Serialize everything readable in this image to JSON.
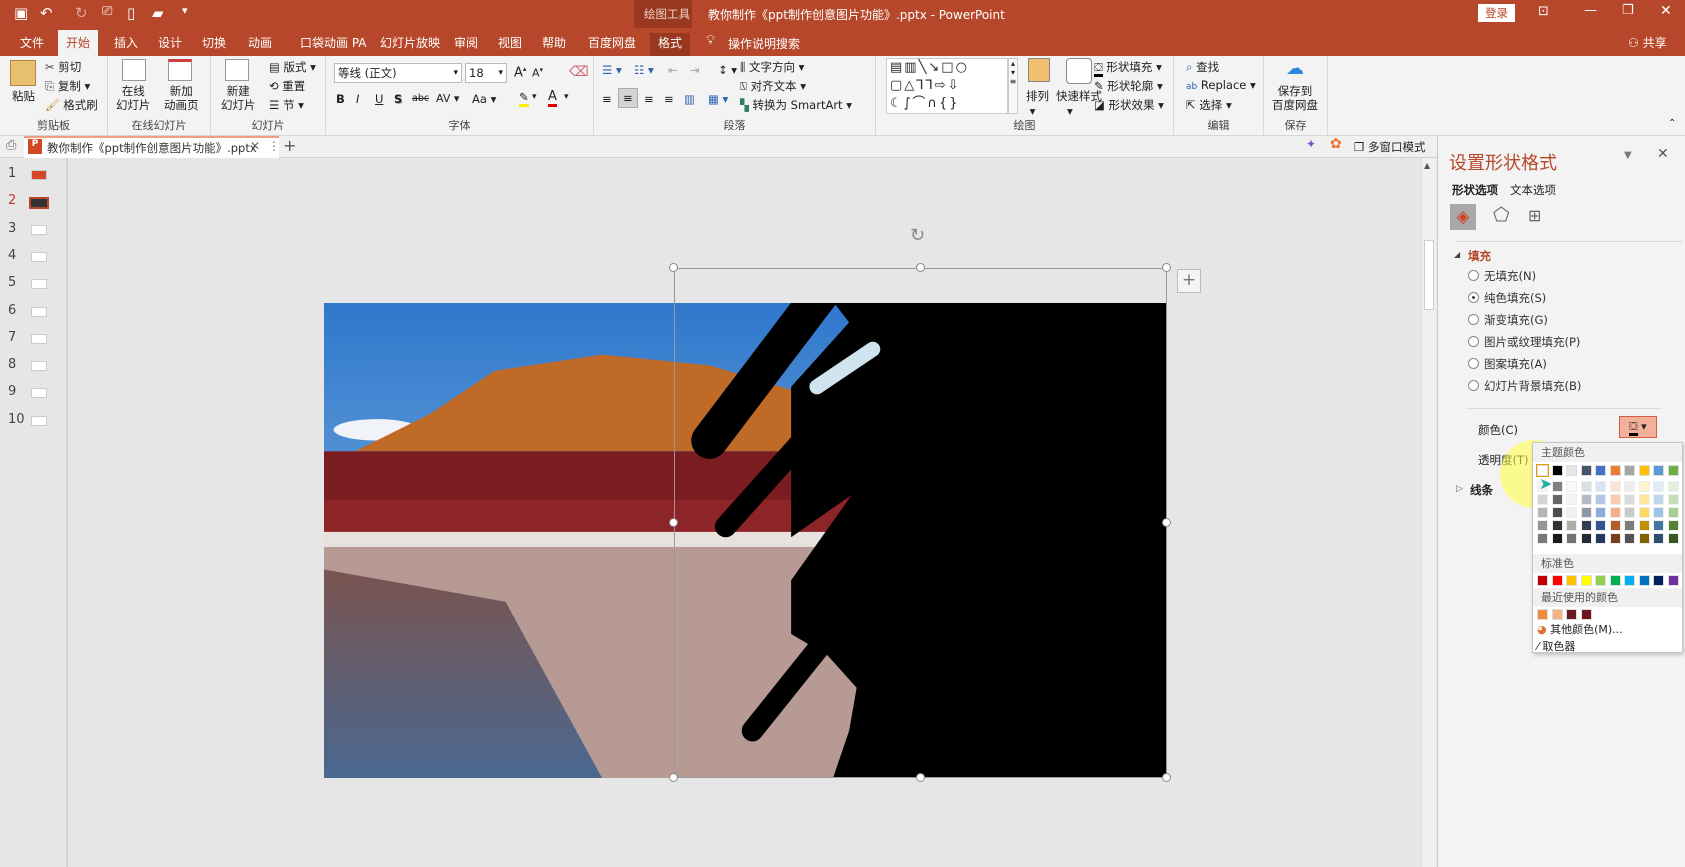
{
  "titlebar": {
    "title": "教你制作《ppt制作创意图片功能》.pptx  -  PowerPoint",
    "context_tool": "绘图工具",
    "login": "登录",
    "qat": [
      "save-icon",
      "undo-icon",
      "redo-icon",
      "present-icon",
      "new-icon",
      "open-icon",
      "customize-icon"
    ]
  },
  "tabs": [
    {
      "label": "文件"
    },
    {
      "label": "开始",
      "active": true
    },
    {
      "label": "插入"
    },
    {
      "label": "设计"
    },
    {
      "label": "切换"
    },
    {
      "label": "动画"
    },
    {
      "label": "口袋动画 PA"
    },
    {
      "label": "幻灯片放映"
    },
    {
      "label": "审阅"
    },
    {
      "label": "视图"
    },
    {
      "label": "帮助"
    },
    {
      "label": "百度网盘"
    },
    {
      "label": "格式"
    }
  ],
  "tell_me": "操作说明搜索",
  "share": "共享",
  "ribbon": {
    "clipboard": {
      "label": "剪贴板",
      "paste": "粘贴",
      "cut": "剪切",
      "copy": "复制",
      "format_painter": "格式刷"
    },
    "online": {
      "label": "在线幻灯片",
      "online_slides": "在线\n幻灯片",
      "new_anim": "新加\n动画页"
    },
    "slides": {
      "label": "幻灯片",
      "new_slide": "新建\n幻灯片",
      "layout": "版式",
      "reset": "重置",
      "section": "节"
    },
    "font": {
      "label": "字体",
      "font_name": "等线 (正文)",
      "font_size": "18",
      "buttons": [
        "B",
        "I",
        "U",
        "S",
        "abc",
        "AV",
        "Aa"
      ]
    },
    "paragraph": {
      "label": "段落",
      "text_direction": "文字方向",
      "align_text": "对齐文本",
      "smartart": "转换为 SmartArt"
    },
    "drawing": {
      "label": "绘图",
      "arrange": "排列",
      "quick_styles": "快速样式",
      "shape_fill": "形状填充",
      "shape_outline": "形状轮廓",
      "shape_effects": "形状效果"
    },
    "editing": {
      "label": "编辑",
      "find": "查找",
      "replace": "Replace",
      "select": "选择"
    },
    "save": {
      "label": "保存",
      "save_baidu": "保存到\n百度网盘"
    }
  },
  "doc_tab": {
    "name": "教你制作《ppt制作创意图片功能》.pptx",
    "multiwindow": "多窗口模式"
  },
  "slides": [
    {
      "n": "1"
    },
    {
      "n": "2",
      "selected": true
    },
    {
      "n": "3"
    },
    {
      "n": "4"
    },
    {
      "n": "5"
    },
    {
      "n": "6"
    },
    {
      "n": "7"
    },
    {
      "n": "8"
    },
    {
      "n": "9"
    },
    {
      "n": "10"
    }
  ],
  "pane": {
    "title": "设置形状格式",
    "tab_shape": "形状选项",
    "tab_text": "文本选项",
    "fill_header": "填充",
    "fill_options": [
      {
        "label": "无填充(N)",
        "checked": false
      },
      {
        "label": "纯色填充(S)",
        "checked": true
      },
      {
        "label": "渐变填充(G)",
        "checked": false
      },
      {
        "label": "图片或纹理填充(P)",
        "checked": false
      },
      {
        "label": "图案填充(A)",
        "checked": false
      },
      {
        "label": "幻灯片背景填充(B)",
        "checked": false
      }
    ],
    "color_label": "颜色(C)",
    "transparency_label": "透明度(T)",
    "line_header": "线条"
  },
  "picker": {
    "theme_header": "主题颜色",
    "standard_header": "标准色",
    "recent_header": "最近使用的颜色",
    "theme_colors": [
      "#FFFFFF",
      "#000000",
      "#E7E6E6",
      "#44546A",
      "#4472C4",
      "#ED7D31",
      "#A5A5A5",
      "#FFC000",
      "#5B9BD5",
      "#70AD47"
    ],
    "standard_colors": [
      "#C00000",
      "#FF0000",
      "#FFC000",
      "#FFFF00",
      "#92D050",
      "#00B050",
      "#00B0F0",
      "#0070C0",
      "#002060",
      "#7030A0"
    ],
    "recent_colors": [
      "#F08A3C",
      "#F4B183",
      "#6B1A24",
      "#6E1420"
    ],
    "more_colors": "其他颜色(M)...",
    "eyedropper": "取色器"
  },
  "colors": {
    "accent": "#B7472A"
  }
}
